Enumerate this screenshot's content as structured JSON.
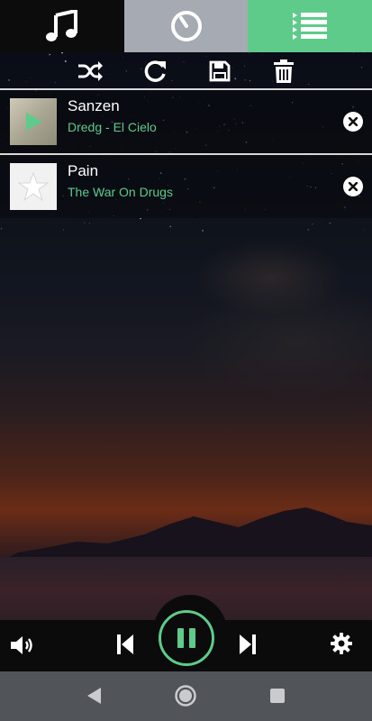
{
  "tabs": [
    {
      "name": "library",
      "icon": "music-note-icon"
    },
    {
      "name": "now-playing",
      "icon": "dial-icon"
    },
    {
      "name": "queue",
      "icon": "playlist-icon"
    }
  ],
  "toolbar": {
    "icons": [
      "shuffle-icon",
      "refresh-icon",
      "save-icon",
      "trash-icon"
    ]
  },
  "queue": {
    "items": [
      {
        "title": "Sanzen",
        "subtitle": "Dredg - El Cielo",
        "status": "playing"
      },
      {
        "title": "Pain",
        "subtitle": "The War On Drugs",
        "status": "no-artwork"
      }
    ]
  },
  "player": {
    "state": "playing",
    "icons": [
      "volume-icon",
      "previous-icon",
      "pause-icon",
      "next-icon",
      "settings-icon"
    ]
  },
  "colors": {
    "accent": "#5ecb8a",
    "tab_library_bg": "#0c0c0c",
    "tab_nowplaying_bg": "#a5aab3",
    "tab_queue_bg": "#5ecb8a",
    "nav_bg": "#515459"
  }
}
